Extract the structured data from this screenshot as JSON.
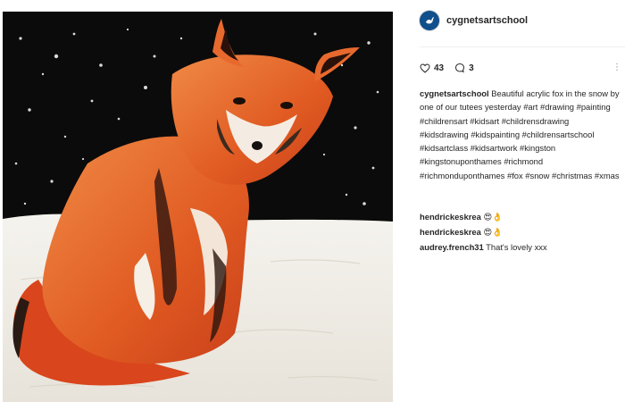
{
  "post": {
    "username": "cygnetsartschool",
    "likes_count": "43",
    "comments_count": "3",
    "caption_user": "cygnetsartschool",
    "caption_text": "Beautiful acrylic fox in the snow by one of our tutees yesterday #art #drawing #painting #childrensart #kidsart #childrensdrawing #kidsdrawing #kidspainting #childrensartschool #kidsartclass #kidsartwork #kingston #kingstonuponthames #richmond #richmonduponthames #fox #snow #christmas #xmas",
    "photo_subject": "acrylic painting of an orange fox sitting in snow under a black starry sky"
  },
  "comments": [
    {
      "user": "hendrickeskrea",
      "text": "😍👌"
    },
    {
      "user": "hendrickeskrea",
      "text": "😍👌"
    },
    {
      "user": "audrey.french31",
      "text": "That's lovely xxx"
    }
  ],
  "icons": {
    "like": "heart-outline-icon",
    "comment": "speech-bubble-icon",
    "more": "ellipsis-icon",
    "avatar": "swan-logo"
  },
  "colors": {
    "sky": "#0b0b0b",
    "snow": "#f2f0ea",
    "fox_orange": "#e0632a",
    "avatar_blue": "#0f4f8c"
  }
}
